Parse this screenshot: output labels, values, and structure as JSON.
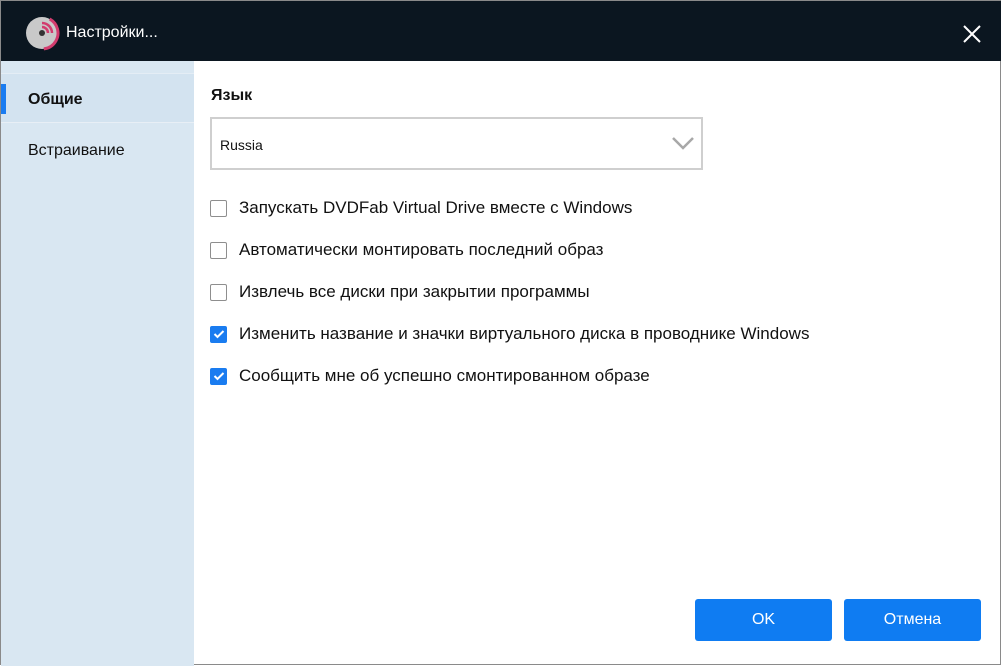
{
  "window": {
    "title": "Настройки..."
  },
  "sidebar": {
    "items": [
      {
        "label": "Общие",
        "active": true
      },
      {
        "label": "Встраивание",
        "active": false
      }
    ]
  },
  "general": {
    "language_label": "Язык",
    "language_value": "Russia",
    "options": [
      {
        "label": "Запускать DVDFab Virtual Drive вместе с Windows",
        "checked": false
      },
      {
        "label": "Автоматически монтировать последний образ",
        "checked": false
      },
      {
        "label": "Извлечь все диски при закрытии программы",
        "checked": false
      },
      {
        "label": "Изменить название и значки виртуального диска в проводнике Windows",
        "checked": true
      },
      {
        "label": "Сообщить мне об успешно смонтированном образе",
        "checked": true
      }
    ]
  },
  "buttons": {
    "ok": "OK",
    "cancel": "Отмена"
  },
  "colors": {
    "accent": "#0f7cf2",
    "titlebar": "#0b1620",
    "sidebar": "#d9e7f2"
  }
}
